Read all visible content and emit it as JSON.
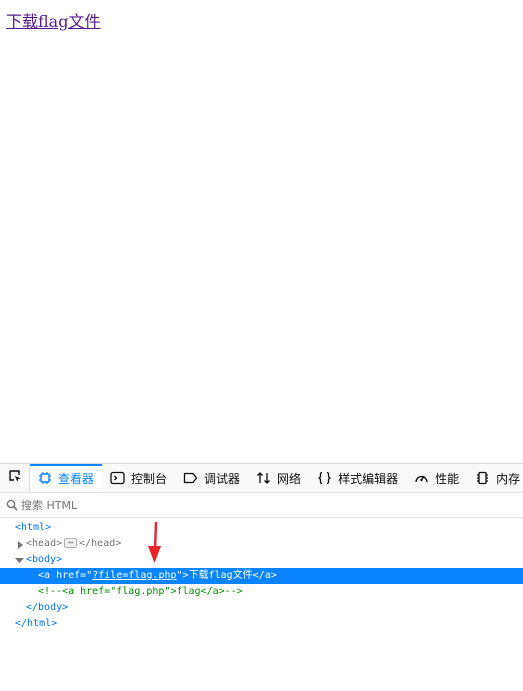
{
  "page": {
    "link_text": "下载flag文件"
  },
  "devtools": {
    "tabs": [
      {
        "icon": "inspector-icon",
        "label": "查看器",
        "selected": true
      },
      {
        "icon": "console-icon",
        "label": "控制台",
        "selected": false
      },
      {
        "icon": "debugger-icon",
        "label": "调试器",
        "selected": false
      },
      {
        "icon": "network-icon",
        "label": "网络",
        "selected": false
      },
      {
        "icon": "style-editor-icon",
        "label": "样式编辑器",
        "selected": false
      },
      {
        "icon": "performance-icon",
        "label": "性能",
        "selected": false
      },
      {
        "icon": "memory-icon",
        "label": "内存",
        "selected": false
      }
    ],
    "search": {
      "placeholder": "搜索 HTML"
    },
    "markup": {
      "html_open": "<html>",
      "head_open": "<head>",
      "head_close": "</head>",
      "ellipsis": "⋯",
      "body_open": "<body>",
      "anchor": {
        "open_start": "<a",
        "attr_name": "href",
        "eq_quote": "=\"",
        "attr_value": "?file=flag.php",
        "close_quote": "\">",
        "text": "下载flag文件",
        "close_tag": "</a>"
      },
      "comment": "<!--<a href=\"flag.php\">flag</a>-->",
      "body_close": "</body>",
      "html_close": "</html>"
    },
    "colors": {
      "selection": "#0a84ff",
      "accent": "#0a84ff",
      "annotation_arrow": "#e8232b"
    }
  }
}
